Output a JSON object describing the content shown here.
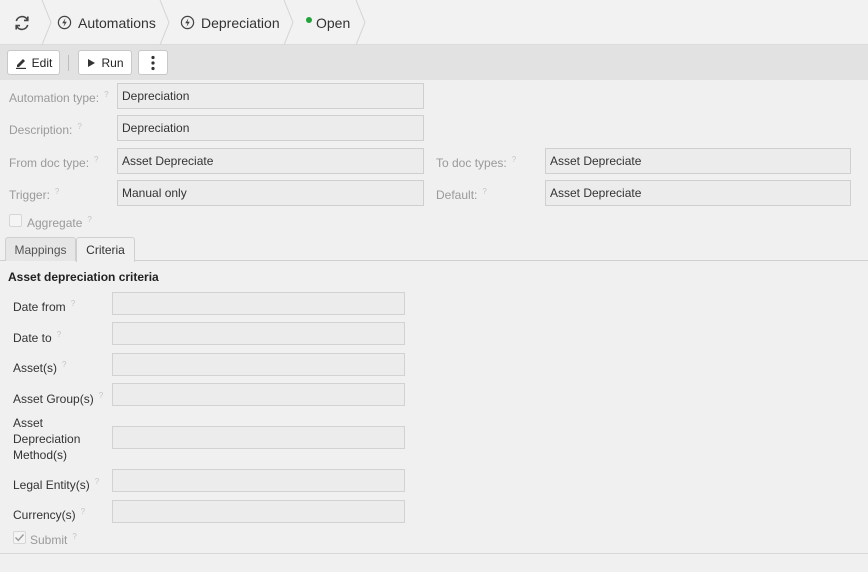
{
  "breadcrumbs": {
    "items": [
      {
        "label": "Automations",
        "icon": "bolt-icon"
      },
      {
        "label": "Depreciation",
        "icon": "bolt-icon"
      }
    ],
    "status": {
      "label": "Open",
      "color": "#22a33a"
    }
  },
  "toolbar": {
    "edit_label": "Edit",
    "run_label": "Run"
  },
  "form": {
    "automation_type": {
      "label": "Automation type:",
      "value": "Depreciation"
    },
    "description": {
      "label": "Description:",
      "value": "Depreciation"
    },
    "from_doc_type": {
      "label": "From doc type:",
      "value": "Asset Depreciate"
    },
    "to_doc_types": {
      "label": "To doc types:",
      "value": "Asset Depreciate"
    },
    "trigger": {
      "label": "Trigger:",
      "value": "Manual only"
    },
    "default": {
      "label": "Default:",
      "value": "Asset Depreciate"
    },
    "aggregate": {
      "label": "Aggregate",
      "checked": false
    }
  },
  "tabs": [
    {
      "label": "Mappings",
      "active": false
    },
    {
      "label": "Criteria",
      "active": true
    }
  ],
  "criteria": {
    "title": "Asset depreciation criteria",
    "fields": {
      "date_from": {
        "label": "Date from",
        "value": ""
      },
      "date_to": {
        "label": "Date to",
        "value": ""
      },
      "assets": {
        "label": "Asset(s)",
        "value": ""
      },
      "asset_groups": {
        "label": "Asset Group(s)",
        "value": ""
      },
      "depreciation_method_1": "Asset",
      "depreciation_method_2": "Depreciation",
      "depreciation_method_3": "Method(s)",
      "legal_entities": {
        "label": "Legal Entity(s)",
        "value": ""
      },
      "currencies": {
        "label": "Currency(s)",
        "value": ""
      }
    },
    "submit": {
      "label": "Submit",
      "checked": true
    }
  },
  "help_mark": "?",
  "colors": {
    "accent_status": "#22a33a",
    "toolbar_bg": "#e2e2e2"
  }
}
